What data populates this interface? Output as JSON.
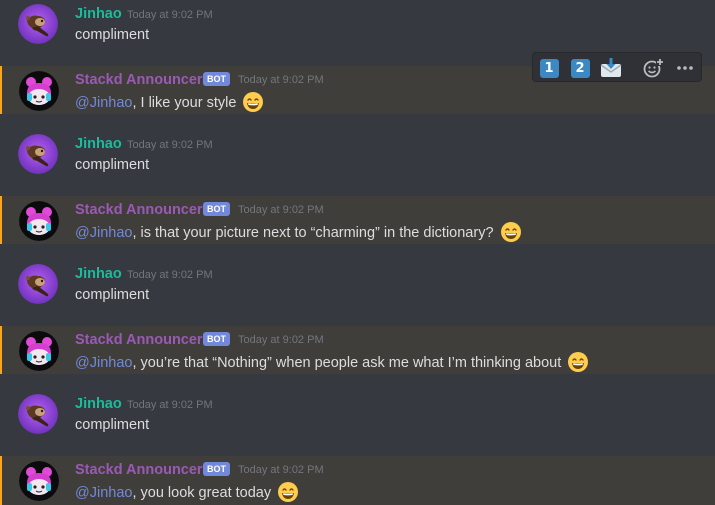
{
  "messages": [
    {
      "author": "Jinhao",
      "author_color": "#1abc9c",
      "bot": false,
      "timestamp": "Today at 9:02 PM",
      "text": "compliment"
    },
    {
      "author": "Stackd Announcer",
      "author_color": "#9b59b6",
      "bot": true,
      "badge": "BOT",
      "timestamp": "Today at 9:02 PM",
      "mention": "@Jinhao",
      "text": ", I like your style",
      "emoji": "grinning-face-emoji"
    },
    {
      "author": "Jinhao",
      "author_color": "#1abc9c",
      "bot": false,
      "timestamp": "Today at 9:02 PM",
      "text": "compliment"
    },
    {
      "author": "Stackd Announcer",
      "author_color": "#9b59b6",
      "bot": true,
      "badge": "BOT",
      "timestamp": "Today at 9:02 PM",
      "mention": "@Jinhao",
      "text": ", is that your picture next to “charming” in the dictionary?",
      "emoji": "grinning-face-emoji"
    },
    {
      "author": "Jinhao",
      "author_color": "#1abc9c",
      "bot": false,
      "timestamp": "Today at 9:02 PM",
      "text": "compliment"
    },
    {
      "author": "Stackd Announcer",
      "author_color": "#9b59b6",
      "bot": true,
      "badge": "BOT",
      "timestamp": "Today at 9:02 PM",
      "mention": "@Jinhao",
      "text": ", you’re that “Nothing” when people ask me what I’m thinking about",
      "emoji": "grinning-face-emoji"
    },
    {
      "author": "Jinhao",
      "author_color": "#1abc9c",
      "bot": false,
      "timestamp": "Today at 9:02 PM",
      "text": "compliment"
    },
    {
      "author": "Stackd Announcer",
      "author_color": "#9b59b6",
      "bot": true,
      "badge": "BOT",
      "timestamp": "Today at 9:02 PM",
      "mention": "@Jinhao",
      "text": ", you look great today",
      "emoji": "grinning-face-emoji"
    }
  ],
  "toolbar": {
    "reaction_1": "1",
    "reaction_2": "2",
    "reaction_3_icon": "incoming-envelope-icon",
    "add_reaction_icon": "add-reaction-icon",
    "more_icon": "more-options-icon"
  },
  "colors": {
    "background": "#36393f",
    "highlight": "#3f3e3a",
    "highlight_border": "#faa61a",
    "mention": "#7289da",
    "bot_badge": "#7289da"
  }
}
